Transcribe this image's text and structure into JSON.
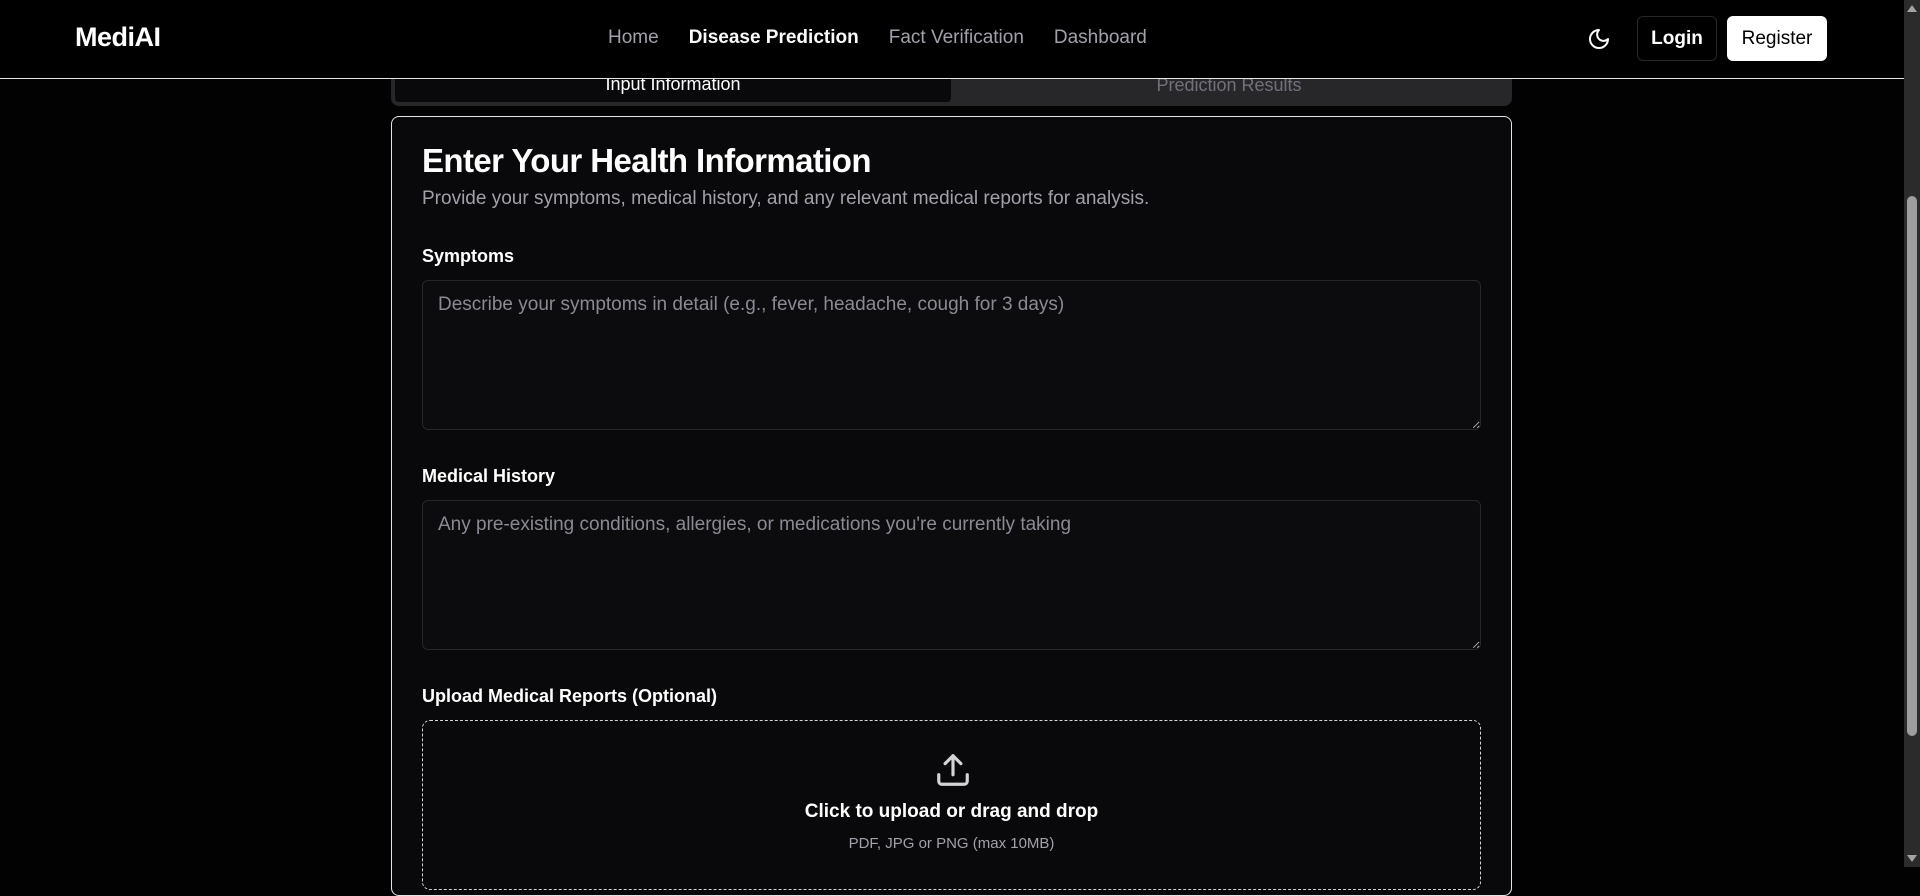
{
  "navbar": {
    "brand": "MediAI",
    "links": [
      {
        "label": "Home",
        "active": false
      },
      {
        "label": "Disease Prediction",
        "active": true
      },
      {
        "label": "Fact Verification",
        "active": false
      },
      {
        "label": "Dashboard",
        "active": false
      }
    ],
    "theme_icon": "moon-icon",
    "login_label": "Login",
    "register_label": "Register"
  },
  "tabs": {
    "input_label": "Input Information",
    "results_label": "Prediction Results"
  },
  "form": {
    "title": "Enter Your Health Information",
    "description": "Provide your symptoms, medical history, and any relevant medical reports for analysis.",
    "symptoms": {
      "label": "Symptoms",
      "placeholder": "Describe your symptoms in detail (e.g., fever, headache, cough for 3 days)",
      "value": ""
    },
    "history": {
      "label": "Medical History",
      "placeholder": "Any pre-existing conditions, allergies, or medications you're currently taking",
      "value": ""
    },
    "upload": {
      "label": "Upload Medical Reports (Optional)",
      "icon": "upload-icon",
      "main_text": "Click to upload or drag and drop",
      "sub_text": "PDF, JPG or PNG (max 10MB)"
    }
  },
  "colors": {
    "background": "#020203",
    "card": "#09090b",
    "border": "#e4e4e7",
    "muted_text": "#a1a1aa",
    "accent": "#ffffff"
  }
}
